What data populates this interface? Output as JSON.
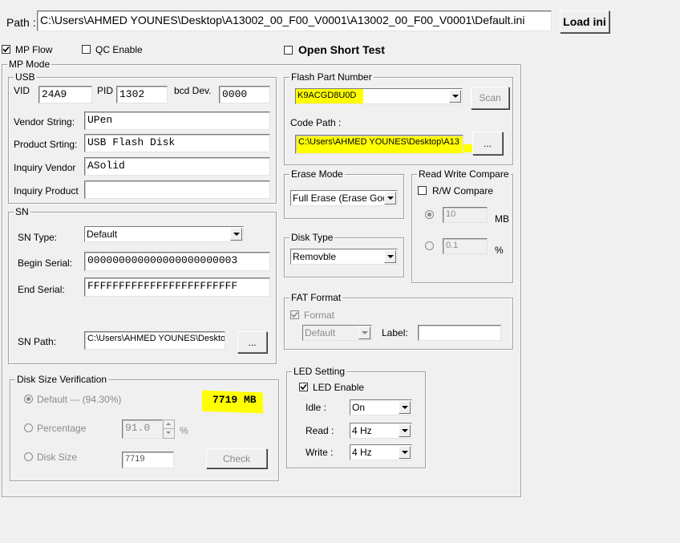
{
  "path_bar": {
    "label": "Path :",
    "value": "C:\\Users\\AHMED YOUNES\\Desktop\\A13002_00_F00_V0001\\A13002_00_F00_V0001\\Default.ini",
    "load_button": "Load ini"
  },
  "top_options": {
    "mp_flow": {
      "label": "MP Flow",
      "checked": true
    },
    "qc_enable": {
      "label": "QC Enable",
      "checked": false
    },
    "open_short_test": {
      "label": "Open Short Test",
      "checked": false
    }
  },
  "mp_mode": {
    "title": "MP Mode",
    "usb": {
      "title": "USB",
      "vid_label": "VID",
      "vid_value": "24A9",
      "pid_label": "PID",
      "pid_value": "1302",
      "bcd_label": "bcd Dev.",
      "bcd_value": "0000",
      "vendor_string_label": "Vendor String:",
      "vendor_string_value": "UPen",
      "product_string_label": "Product Srting:",
      "product_string_value": "USB Flash Disk",
      "inquiry_vendor_label": "Inquiry Vendor",
      "inquiry_vendor_value": "ASolid",
      "inquiry_product_label": "Inquiry Product",
      "inquiry_product_value": ""
    },
    "sn": {
      "title": "SN",
      "type_label": "SN Type:",
      "type_value": "Default",
      "begin_label": "Begin Serial:",
      "begin_value": "000000000000000000000003",
      "end_label": "End Serial:",
      "end_value": "FFFFFFFFFFFFFFFFFFFFFFFF",
      "path_label": "SN Path:",
      "path_value": "C:\\Users\\AHMED YOUNES\\Desktop",
      "browse_button": "..."
    },
    "disk_size": {
      "title": "Disk Size Verification",
      "default_label": "Default --- (94.30%)",
      "size_display": "7719  MB",
      "percentage_label": "Percentage",
      "percentage_value": "91.0",
      "percent_sign": "%",
      "disk_size_label": "Disk Size",
      "disk_size_value": "7719",
      "check_button": "Check"
    },
    "flash": {
      "title": "Flash Part Number",
      "part_number": "K9ACGD8U0D",
      "scan_button": "Scan",
      "code_path_label": "Code Path :",
      "code_path_value": "C:\\Users\\AHMED YOUNES\\Desktop\\A13",
      "browse_button": "..."
    },
    "erase_mode": {
      "title": "Erase Mode",
      "value": "Full Erase (Erase Good)"
    },
    "rw_compare": {
      "title": "Read Write Compare",
      "checkbox_label": "R/W Compare",
      "mb_value": "10",
      "mb_unit": "MB",
      "percent_value": "0.1",
      "percent_unit": "%"
    },
    "disk_type": {
      "title": "Disk Type",
      "value": "Removble"
    },
    "fat_format": {
      "title": "FAT Format",
      "format_label": "Format",
      "format_value": "Default",
      "label_label": "Label:",
      "label_value": ""
    },
    "led": {
      "title": "LED Setting",
      "enable_label": "LED Enable",
      "idle_label": "Idle :",
      "idle_value": "On",
      "read_label": "Read :",
      "read_value": "4 Hz",
      "write_label": "Write :",
      "write_value": "4 Hz"
    }
  },
  "colors": {
    "highlight": "#ffff00",
    "background": "#f0f0f0"
  }
}
